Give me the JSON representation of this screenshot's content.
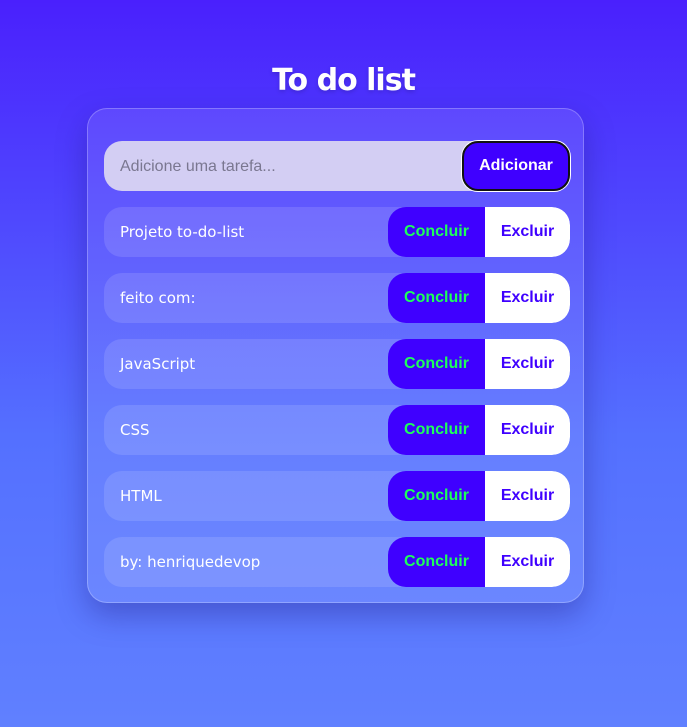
{
  "title": "To do list",
  "input": {
    "placeholder": "Adicione uma tarefa...",
    "value": ""
  },
  "add_label": "Adicionar",
  "complete_label": "Concluir",
  "delete_label": "Excluir",
  "tasks": [
    "Projeto to-do-list",
    "feito com:",
    "JavaScript",
    "CSS",
    "HTML",
    "by: henriquedevop"
  ]
}
